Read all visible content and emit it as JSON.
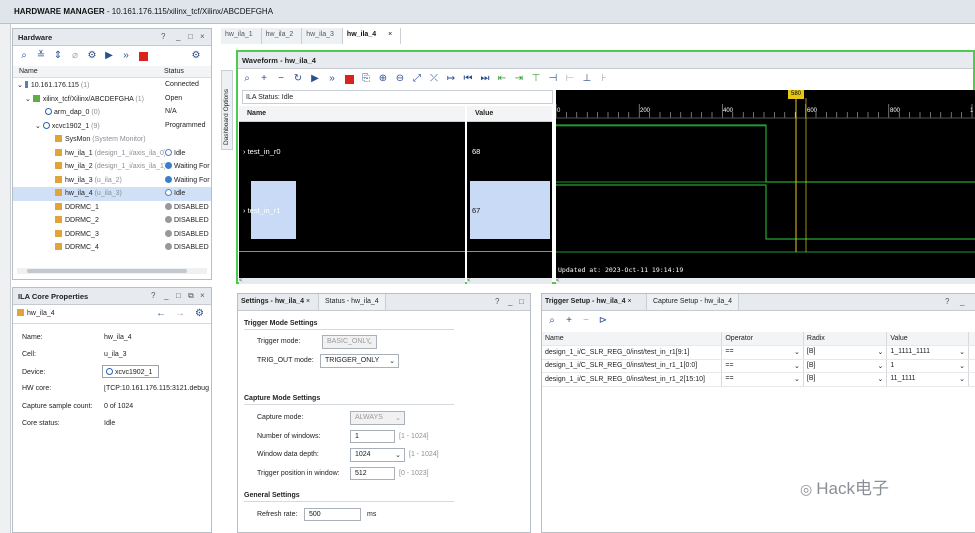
{
  "app": {
    "title_bold": "HARDWARE MANAGER",
    "title_rest": " - 10.161.176.115/xilinx_tcf/Xilinx/ABCDEFGHA"
  },
  "hardware": {
    "title": "Hardware",
    "columns": [
      "Name",
      "Status"
    ],
    "rows": [
      {
        "name": "10.161.176.115",
        "count": "(1)",
        "status": "Connected"
      },
      {
        "name": "xilinx_tcf/Xilinx/ABCDEFGHA",
        "count": "(1)",
        "status": "Open"
      },
      {
        "name": "arm_dap_0",
        "count": "(0)",
        "status": "N/A"
      },
      {
        "name": "xcvc1902_1",
        "count": "(9)",
        "status": "Programmed"
      },
      {
        "name": "SysMon",
        "count": "(System Monitor)",
        "status": ""
      },
      {
        "name": "hw_ila_1",
        "count": "(design_1_i/axis_ila_0)",
        "status": "Idle"
      },
      {
        "name": "hw_ila_2",
        "count": "(design_1_i/axis_ila_1)",
        "status": "Waiting For"
      },
      {
        "name": "hw_ila_3",
        "count": "(u_ila_2)",
        "status": "Waiting For"
      },
      {
        "name": "hw_ila_4",
        "count": "(u_ila_3)",
        "status": "Idle"
      },
      {
        "name": "DDRMC_1",
        "count": "",
        "status": "DISABLED"
      },
      {
        "name": "DDRMC_2",
        "count": "",
        "status": "DISABLED"
      },
      {
        "name": "DDRMC_3",
        "count": "",
        "status": "DISABLED"
      },
      {
        "name": "DDRMC_4",
        "count": "",
        "status": "DISABLED"
      }
    ]
  },
  "ila_props": {
    "title": "ILA Core Properties",
    "core": "hw_ila_4",
    "fields": [
      {
        "label": "Name:",
        "value": "hw_ila_4"
      },
      {
        "label": "Cell:",
        "value": "u_ila_3"
      },
      {
        "label": "Device:",
        "value": "xcvc1902_1"
      },
      {
        "label": "HW core:",
        "value": "[TCP:10.161.176.115:3121.debug"
      },
      {
        "label": "Capture sample count:",
        "value": "0 of 1024"
      },
      {
        "label": "Core status:",
        "value": "Idle"
      }
    ]
  },
  "tabs": [
    "hw_ila_1",
    "hw_ila_2",
    "hw_ila_3",
    "hw_ila_4"
  ],
  "waveform": {
    "title": "Waveform - hw_ila_4",
    "side_tab": "Dashboard Options",
    "status": "ILA Status:  Idle",
    "col_name": "Name",
    "col_value": "Value",
    "signals": [
      {
        "name": "test_in_r0",
        "value": "68"
      },
      {
        "name": "test_in_r1",
        "value": "67"
      }
    ],
    "ticks": [
      "0",
      "200",
      "400",
      "600",
      "800",
      "1"
    ],
    "marker": "580",
    "updated": "Updated at: 2023-Oct-11 19:14:19",
    "colors": {
      "bg": "#000000",
      "trace": "#2ecc40",
      "marker": "#e6c619",
      "frame": "#4ccb4c"
    }
  },
  "settings": {
    "tab_active": "Settings - hw_ila_4",
    "tab_other": "Status - hw_ila_4",
    "trigger_mode_section": "Trigger Mode Settings",
    "trigger_mode_label": "Trigger mode:",
    "trigger_mode_value": "BASIC_ONLY",
    "trig_out_label": "TRIG_OUT mode:",
    "trig_out_value": "TRIGGER_ONLY",
    "capture_section": "Capture Mode Settings",
    "capture_mode_label": "Capture mode:",
    "capture_mode_value": "ALWAYS",
    "windows_label": "Number of windows:",
    "windows_value": "1",
    "windows_hint": "[1 - 1024]",
    "depth_label": "Window data depth:",
    "depth_value": "1024",
    "depth_hint": "[1 - 1024]",
    "trigpos_label": "Trigger position in window:",
    "trigpos_value": "512",
    "trigpos_hint": "[0 - 1023]",
    "general_section": "General Settings",
    "refresh_label": "Refresh rate:",
    "refresh_value": "500",
    "refresh_unit": "ms"
  },
  "trigger_setup": {
    "tab_active": "Trigger Setup - hw_ila_4",
    "tab_other": "Capture Setup - hw_ila_4",
    "columns": [
      "Name",
      "Operator",
      "Radix",
      "Value"
    ],
    "rows": [
      {
        "name": "design_1_i/C_SLR_REG_0/inst/test_in_r1[9:1]",
        "op": "==",
        "radix": "[B]",
        "value": "1_1111_1111"
      },
      {
        "name": "design_1_i/C_SLR_REG_0/inst/test_in_r1_1[0:0]",
        "op": "==",
        "radix": "[B]",
        "value": "1"
      },
      {
        "name": "design_1_i/C_SLR_REG_0/inst/test_in_r1_2[15:10]",
        "op": "==",
        "radix": "[B]",
        "value": "11_1111"
      }
    ]
  },
  "watermark": "Hack电子"
}
